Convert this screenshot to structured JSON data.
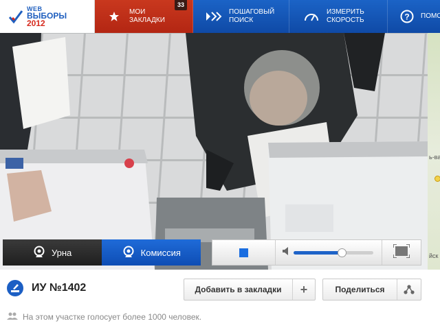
{
  "logo": {
    "line1": "WEB",
    "line2": "ВЫБОРЫ",
    "line3": "2012"
  },
  "nav": {
    "bookmarks": {
      "line1": "МОИ",
      "line2": "ЗАКЛАДКИ",
      "count": "33",
      "icon": "star-icon"
    },
    "search": {
      "line1": "ПОШАГОВЫЙ",
      "line2": "ПОИСК",
      "icon": "step-arrows-icon"
    },
    "speed": {
      "line1": "ИЗМЕРИТЬ",
      "line2": "СКОРОСТЬ",
      "icon": "speedometer-icon"
    },
    "help": {
      "line1": "ПОМОЩ",
      "icon": "question-icon"
    }
  },
  "map": {
    "label1": "ь-ва",
    "label2": "йск"
  },
  "controls": {
    "camera1": "Урна",
    "camera2": "Комиссия",
    "active_camera": "Комиссия",
    "volume_level": 0.6
  },
  "station": {
    "title": "ИУ №1402",
    "add_bookmark": "Добавить в закладки",
    "share": "Поделиться",
    "voters_note": "На этом участке голосует более 1000 человек."
  },
  "colors": {
    "nav_blue": "#1558bd",
    "nav_red": "#c0311a",
    "active_camera_blue": "#1a63cf"
  }
}
